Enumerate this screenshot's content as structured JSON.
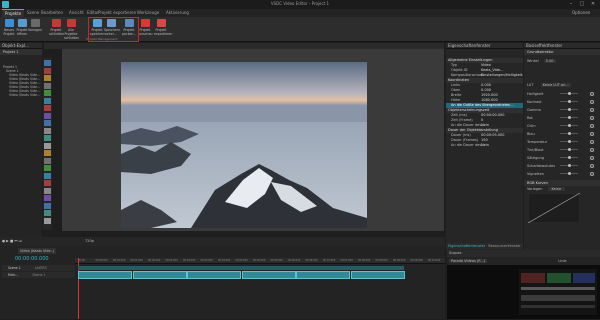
{
  "window": {
    "title": "VSDC Video Editor - Project 1",
    "options_label": "Optionen"
  },
  "menu_tabs": [
    "Projekte",
    "Szene",
    "Bearbeiten",
    "Ansicht",
    "Editor",
    "Projekt exportieren",
    "Werkzeuge",
    "Aktivierung"
  ],
  "ribbon": {
    "buttons": [
      {
        "label": "Neues Projekt",
        "color": "#3a8fd8"
      },
      {
        "label": "Projekt öffnen",
        "color": "#5a9ad0"
      },
      {
        "label": "Vorlagen",
        "color": "#6a6a6a"
      },
      {
        "label": "Projekt schließen",
        "color": "#c83838"
      },
      {
        "label": "Alle Projekte schließen",
        "color": "#c83838"
      },
      {
        "label": "Projekt speichern",
        "color": "#5aa0d8"
      },
      {
        "label": "Speichern unter...",
        "color": "#6a9ad0"
      },
      {
        "label": "Projekt packen...",
        "color": "#5a8ac0"
      },
      {
        "label": "Projekt vorschau",
        "color": "#d83838"
      },
      {
        "label": "Projekt exportieren",
        "color": "#d84848"
      }
    ],
    "group_label": "Projekt-Management"
  },
  "left_panel": {
    "title": "Objekt-Expl...",
    "tab": "Projekt 1",
    "tree": [
      "Projekt 1",
      "Szene 1",
      "Video (Keats Vide...",
      "Video (Keats Vide...",
      "Video (Keats Vide...",
      "Video (Keats Vide...",
      "Video (Keats Vide...",
      "Video (Keats Vide..."
    ]
  },
  "canvas": {
    "zoom": "Szene"
  },
  "properties": {
    "title": "Eigenschaftenfenster",
    "rows": [
      {
        "label": "Allgemeine Einstellungen",
        "type": "section"
      },
      {
        "label": "Typ",
        "value": "Video"
      },
      {
        "label": "Objekt-ID",
        "value": "Keats_Vide..."
      },
      {
        "label": "Kompositionsmodu",
        "value": "Einstellungen/Helligkeit..."
      },
      {
        "label": "Koordinaten",
        "type": "section"
      },
      {
        "label": "Links",
        "value": "0.000"
      },
      {
        "label": "Oben",
        "value": "0.000"
      },
      {
        "label": "Breite",
        "value": "1920.000"
      },
      {
        "label": "Höhe",
        "value": "1080.000"
      },
      {
        "label": "An die Größe des übergeordneten...",
        "type": "selected"
      },
      {
        "label": "Objekterscheinungszeit",
        "type": "section"
      },
      {
        "label": "Zeit (ms)",
        "value": "00:00:00.000"
      },
      {
        "label": "Zeit (Frame)",
        "value": "0"
      },
      {
        "label": "An die Dauer des...",
        "value": "Nein"
      },
      {
        "label": "Dauer der Objektdarstellung",
        "type": "section"
      },
      {
        "label": "Dauer (ms)",
        "value": "00:00:05.000"
      },
      {
        "label": "Dauer (Frames)",
        "value": "150"
      },
      {
        "label": "An die Dauer des...",
        "value": "Nein"
      }
    ],
    "bottom_tabs": [
      "Eigenschaftenfenster",
      "Ressourcenfenster"
    ]
  },
  "basic_effects": {
    "title": "Basiseffektfenster",
    "section1": "Grundkorrektur",
    "winkel": "0.00",
    "lut_label": "LUT",
    "lut_value": "Keine LUT an...",
    "sliders": [
      {
        "label": "Helligkeit",
        "value": 0.5
      },
      {
        "label": "Kontrast",
        "value": 0.5
      },
      {
        "label": "Gamma",
        "value": 0.5
      },
      {
        "label": "Rot",
        "value": 0.5
      },
      {
        "label": "Grün",
        "value": 0.5
      },
      {
        "label": "Blau",
        "value": 0.5
      },
      {
        "label": "Temperatur",
        "value": 0.5
      },
      {
        "label": "Tint/Blast",
        "value": 0.5
      },
      {
        "label": "Sättigung",
        "value": 0.5
      },
      {
        "label": "Scharfabsolutes",
        "value": 0.5
      },
      {
        "label": "Vignetten",
        "value": 0.5
      }
    ],
    "section2": "RGB Kurven",
    "vorlagen_label": "Vorlagen",
    "vorlagen_value": "Keine"
  },
  "timeline": {
    "tab": "Video (Keats Vide..)",
    "timecode": "00:00:00.000",
    "zoom": "720p",
    "tracks": [
      {
        "name": "Szene 1",
        "sub": "LAYERS"
      },
      {
        "name": "Mich...",
        "sub": "Ebene 1"
      }
    ],
    "ruler_ticks": [
      "00:00",
      "00:00.500",
      "00:01.000",
      "00:01.500",
      "00:02.000",
      "00:02.500",
      "00:03.000",
      "00:03.500",
      "00:04.000",
      "00:04.500",
      "00:05.000",
      "00:05.500",
      "00:06.000",
      "00:06.500",
      "00:07.000",
      "00:07.500",
      "00:08.000",
      "00:08.500",
      "00:09.000",
      "00:09.500",
      "00:10.000"
    ]
  },
  "scopes": {
    "title": "Scopes",
    "mode": "Parade Videos (fl...)",
    "option": "Linie"
  },
  "accent_color": "#3cb4c8"
}
